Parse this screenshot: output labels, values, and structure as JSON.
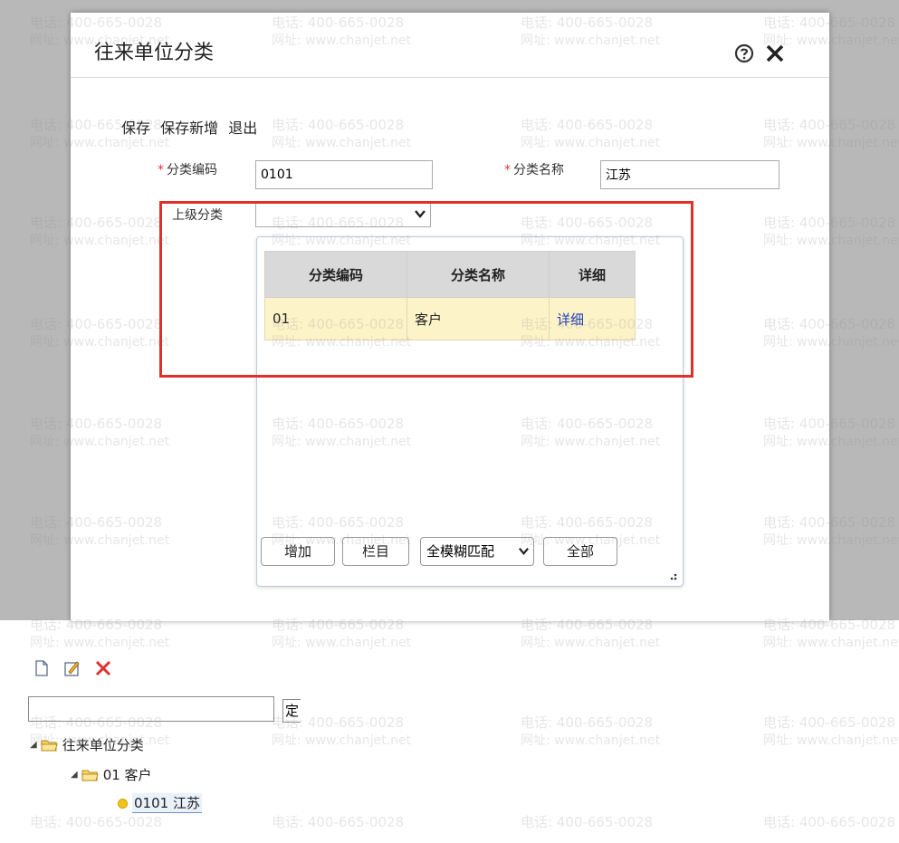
{
  "watermark": {
    "line1": "电话: 400-665-0028",
    "line2": "网址: www.chanjet.net"
  },
  "dialog": {
    "title": "往来单位分类",
    "toolbar": {
      "save": "保存",
      "save_new": "保存新增",
      "exit": "退出"
    },
    "fields": {
      "code_label": "分类编码",
      "code_value": "0101",
      "name_label": "分类名称",
      "name_value": "江苏",
      "parent_label": "上级分类",
      "parent_value": ""
    },
    "dropdown": {
      "columns": [
        "分类编码",
        "分类名称",
        "详细"
      ],
      "rows": [
        {
          "code": "01",
          "name": "客户",
          "detail": "详细"
        }
      ],
      "buttons": {
        "add": "增加",
        "columns": "栏目",
        "match": "全模糊匹配",
        "all": "全部"
      }
    }
  },
  "tree": {
    "search_button": "定",
    "root": "往来单位分类",
    "child": "01 客户",
    "leaf": "0101 江苏"
  },
  "colors": {
    "highlight_box": "#e0302c",
    "selected_row": "#fdf3c8",
    "link": "#1f3fbf"
  }
}
